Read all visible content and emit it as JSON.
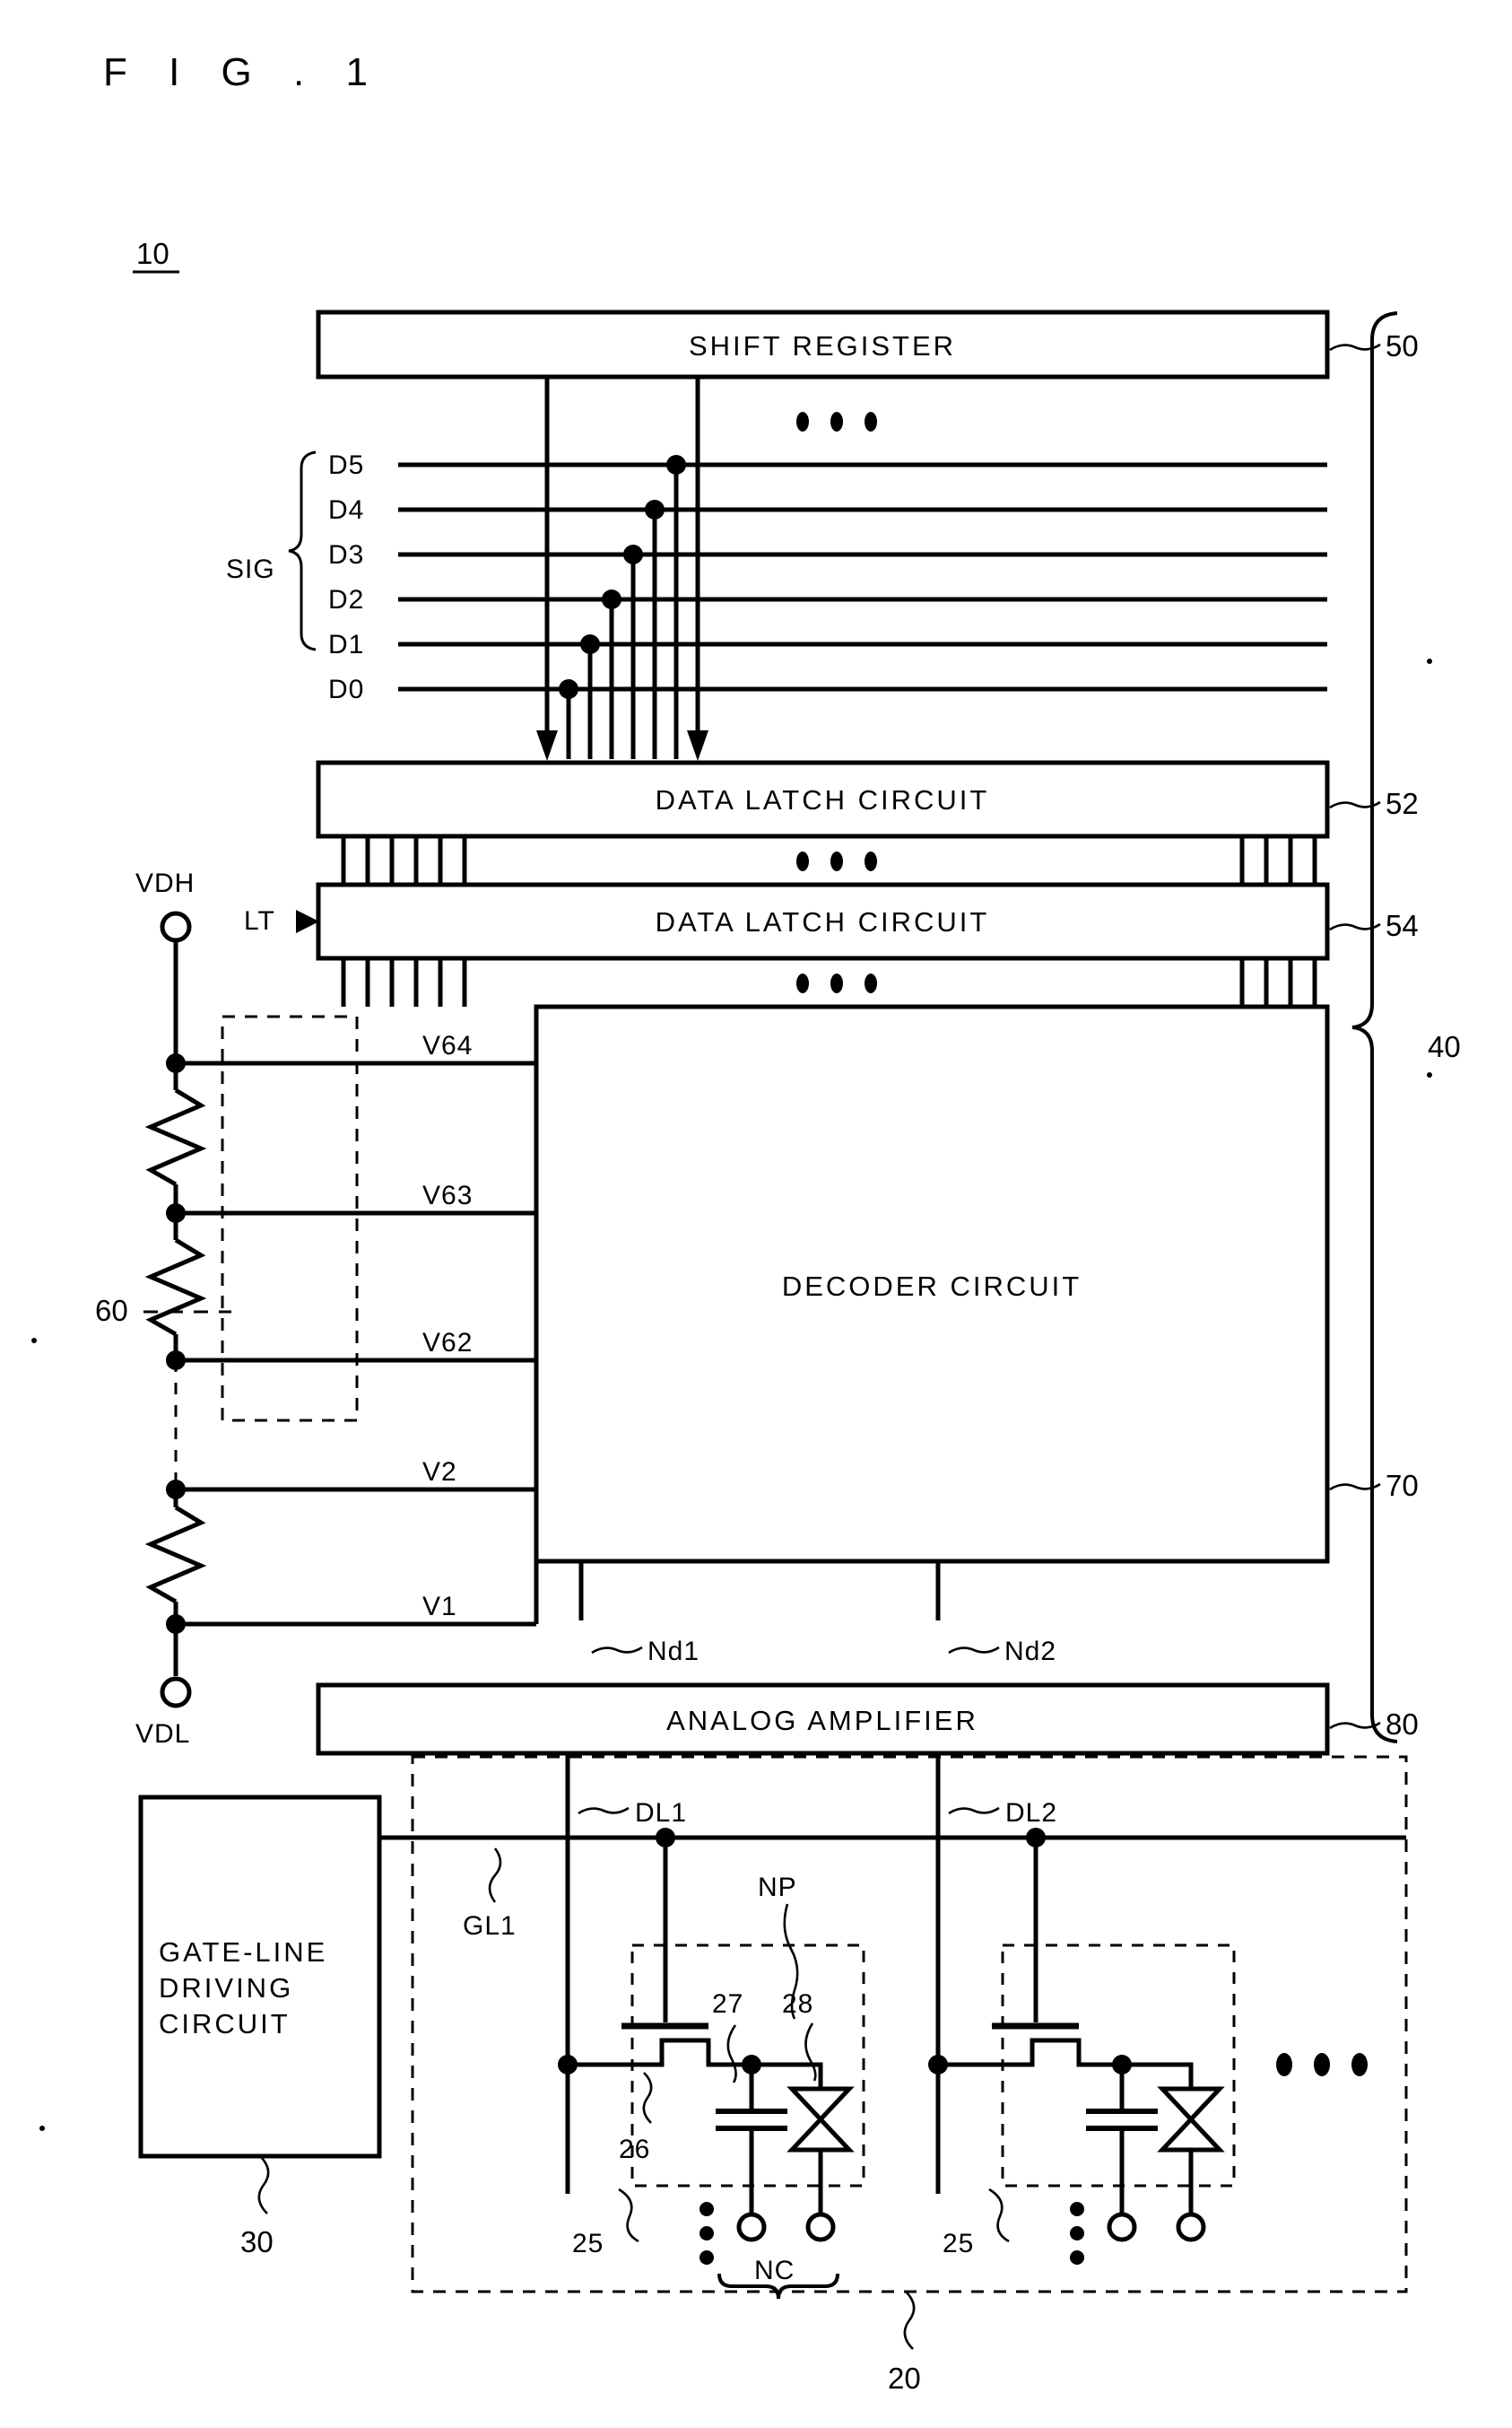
{
  "figure": {
    "title": "F I G . 1",
    "device_ref": "10"
  },
  "blocks": {
    "shift_register": "SHIFT REGISTER",
    "data_latch_1": "DATA LATCH CIRCUIT",
    "data_latch_2": "DATA LATCH CIRCUIT",
    "decoder": "DECODER CIRCUIT",
    "analog_amplifier": "ANALOG AMPLIFIER",
    "gate_line_driver": [
      "GATE-LINE",
      "DRIVING",
      "CIRCUIT"
    ]
  },
  "reference_numerals": {
    "shift_register": "50",
    "data_latch_1": "52",
    "data_latch_2": "54",
    "decoder": "70",
    "analog_amplifier": "80",
    "source_driver_group": "40",
    "ladder": "60",
    "gate_line_driver": "30",
    "panel": "20",
    "pixel": "25",
    "tft": "26",
    "capacitor": "27",
    "display_element": "28"
  },
  "signals": {
    "group_label": "SIG",
    "bits": [
      "D5",
      "D4",
      "D3",
      "D2",
      "D1",
      "D0"
    ],
    "latch_trigger": "LT"
  },
  "power": {
    "high": "VDH",
    "low": "VDL"
  },
  "gray_taps": {
    "upper": [
      "V64",
      "V63",
      "V62"
    ],
    "lower": [
      "V2",
      "V1"
    ]
  },
  "nodes": {
    "decoder_out_1": "Nd1",
    "decoder_out_2": "Nd2",
    "data_line_1": "DL1",
    "data_line_2": "DL2",
    "gate_line_1": "GL1",
    "pixel_node": "NP",
    "common_node": "NC"
  },
  "ellipsis": {
    "horizontal": "• • •",
    "right_cells": "• • •"
  },
  "colors": {
    "ink": "#000000",
    "paper": "#ffffff"
  }
}
